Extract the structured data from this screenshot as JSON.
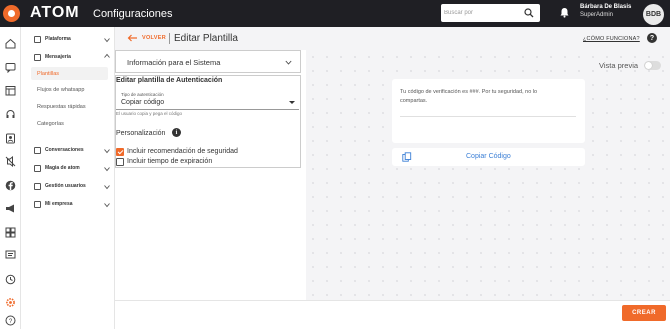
{
  "app": {
    "brand": "ATOM",
    "section": "Configuraciones"
  },
  "search": {
    "placeholder": "Buscar por"
  },
  "user": {
    "name": "Bárbara De Blasis",
    "role": "SuperAdmin",
    "initials": "BDB"
  },
  "rail_icons": [
    "home-icon",
    "chat-icon",
    "calendar-icon",
    "headset-icon",
    "contacts-icon",
    "muted-icon",
    "facebook-icon",
    "megaphone-icon",
    "grid-icon",
    "message-square-icon",
    "clock-icon",
    "settings-icon",
    "help-icon"
  ],
  "sidebar": {
    "items": [
      {
        "label": "Plataforma",
        "icon": "headset-icon"
      },
      {
        "label": "Mensajería",
        "icon": "mail-icon"
      },
      {
        "label": "Conversaciones",
        "icon": "chat-icon"
      },
      {
        "label": "Magia de atom",
        "icon": "magic-wand-icon"
      },
      {
        "label": "Gestión usuarios",
        "icon": "users-icon"
      },
      {
        "label": "Mi empresa",
        "icon": "building-icon"
      }
    ],
    "submenu": [
      "Plantillas",
      "Flujos de whatsapp",
      "Respuestas rápidas",
      "Categorías"
    ],
    "active_submenu": "Plantillas"
  },
  "header": {
    "back_label": "VOLVER",
    "title": "Editar Plantilla",
    "help_link": "¿CÓMO FUNCIONA?"
  },
  "form": {
    "accordion_label": "Información para el Sistema",
    "card_title": "Editar plantilla de Autenticación",
    "auth_type_label": "Tipo de autenticación",
    "auth_type_value": "Copiar código",
    "helper_text": "El usuario copia y pega el código",
    "personalization_title": "Personalización",
    "checkboxes": [
      {
        "label": "Incluir recomendación de seguridad",
        "checked": true
      },
      {
        "label": "Incluir tiempo de expiración",
        "checked": false
      }
    ]
  },
  "preview": {
    "toggle_label": "Vista previa",
    "toggle_on": false,
    "message": "Tu código de verificación es ###. Por tu seguridad, no lo compartas.",
    "copy_button": "Copiar Código"
  },
  "footer": {
    "create_button": "CREAR"
  },
  "colors": {
    "accent": "#f06a2a",
    "topbar": "#1f1f24",
    "link_blue": "#3b7fd6"
  }
}
